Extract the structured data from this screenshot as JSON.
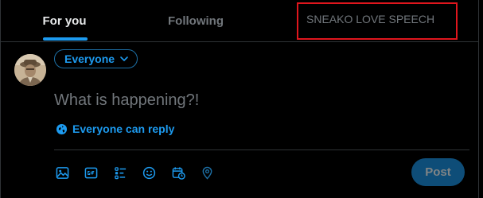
{
  "tabs": {
    "for_you": "For you",
    "following": "Following",
    "custom": "SNEAKO LOVE SPEECH"
  },
  "composer": {
    "audience": "Everyone",
    "placeholder": "What is happening?!",
    "reply_setting": "Everyone can reply",
    "post_label": "Post",
    "toolbar_icons": [
      "image-icon",
      "gif-icon",
      "poll-icon",
      "emoji-icon",
      "schedule-icon",
      "location-icon"
    ]
  },
  "colors": {
    "accent": "#1d9bf0",
    "background": "#000000",
    "border": "#2f3336",
    "muted_text": "#71767b",
    "highlight_box": "#e0161d",
    "post_disabled": "#0e4d78"
  }
}
